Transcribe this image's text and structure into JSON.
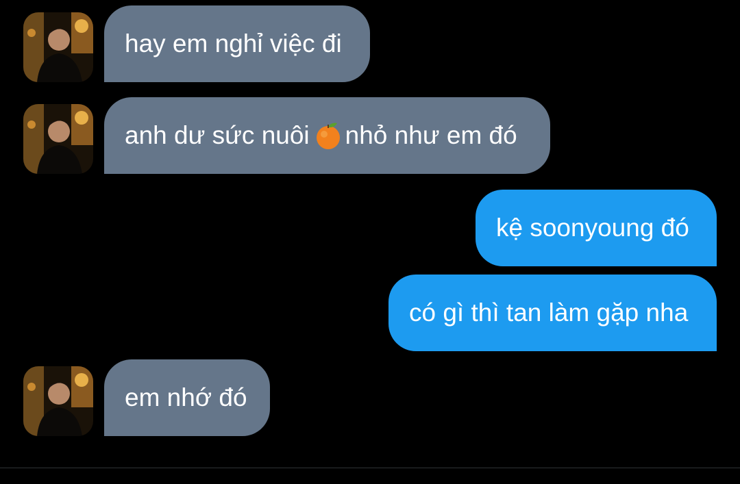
{
  "conversation": {
    "messages": [
      {
        "id": "m1",
        "direction": "incoming",
        "text": "hay em nghỉ việc đi",
        "has_avatar": true
      },
      {
        "id": "m2",
        "direction": "incoming",
        "text_before_emoji": "anh dư sức nuôi",
        "emoji": "orange-emoji",
        "text_after_emoji": "nhỏ như em đó",
        "has_avatar": true
      },
      {
        "id": "m3",
        "direction": "outgoing",
        "text": "kệ soonyoung đó"
      },
      {
        "id": "m4",
        "direction": "outgoing",
        "text": "có gì thì tan làm gặp nha"
      },
      {
        "id": "m5",
        "direction": "incoming",
        "text": "em nhớ đó",
        "has_avatar": true
      }
    ]
  },
  "colors": {
    "background": "#000000",
    "incoming_bubble": "#65768a",
    "outgoing_bubble": "#1d9bf0",
    "text": "#ffffff"
  }
}
